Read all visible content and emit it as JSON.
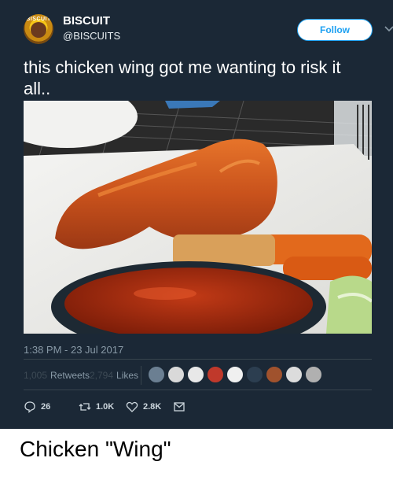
{
  "tweet": {
    "avatar_brand": "BISCUIT",
    "display_name": "BISCUIT",
    "handle": "@BISCUITS",
    "follow_label": "Follow",
    "text": "this chicken wing got me wanting to risk it all..",
    "timestamp": "1:38 PM - 23 Jul 2017",
    "retweets_count": "1,005",
    "retweets_label": "Retweets",
    "likes_count": "2,794",
    "likes_label": "Likes",
    "reply_count": "26",
    "retweet_action_count": "1.0K",
    "like_action_count": "2.8K",
    "icons": [
      "caret-down-icon",
      "reply-icon",
      "retweet-icon",
      "heart-icon",
      "message-icon"
    ]
  },
  "liker_avatar_colors": [
    "#6b7f92",
    "#d9d9d9",
    "#e8e8e8",
    "#c0392b",
    "#f0f0f0",
    "#2c3e50",
    "#a0522d",
    "#dcdcdc",
    "#b0b0b0"
  ],
  "caption": "Chicken \"Wing\"",
  "colors": {
    "card_bg": "#1b2836",
    "accent": "#1da1f2",
    "muted": "#8899a6"
  }
}
